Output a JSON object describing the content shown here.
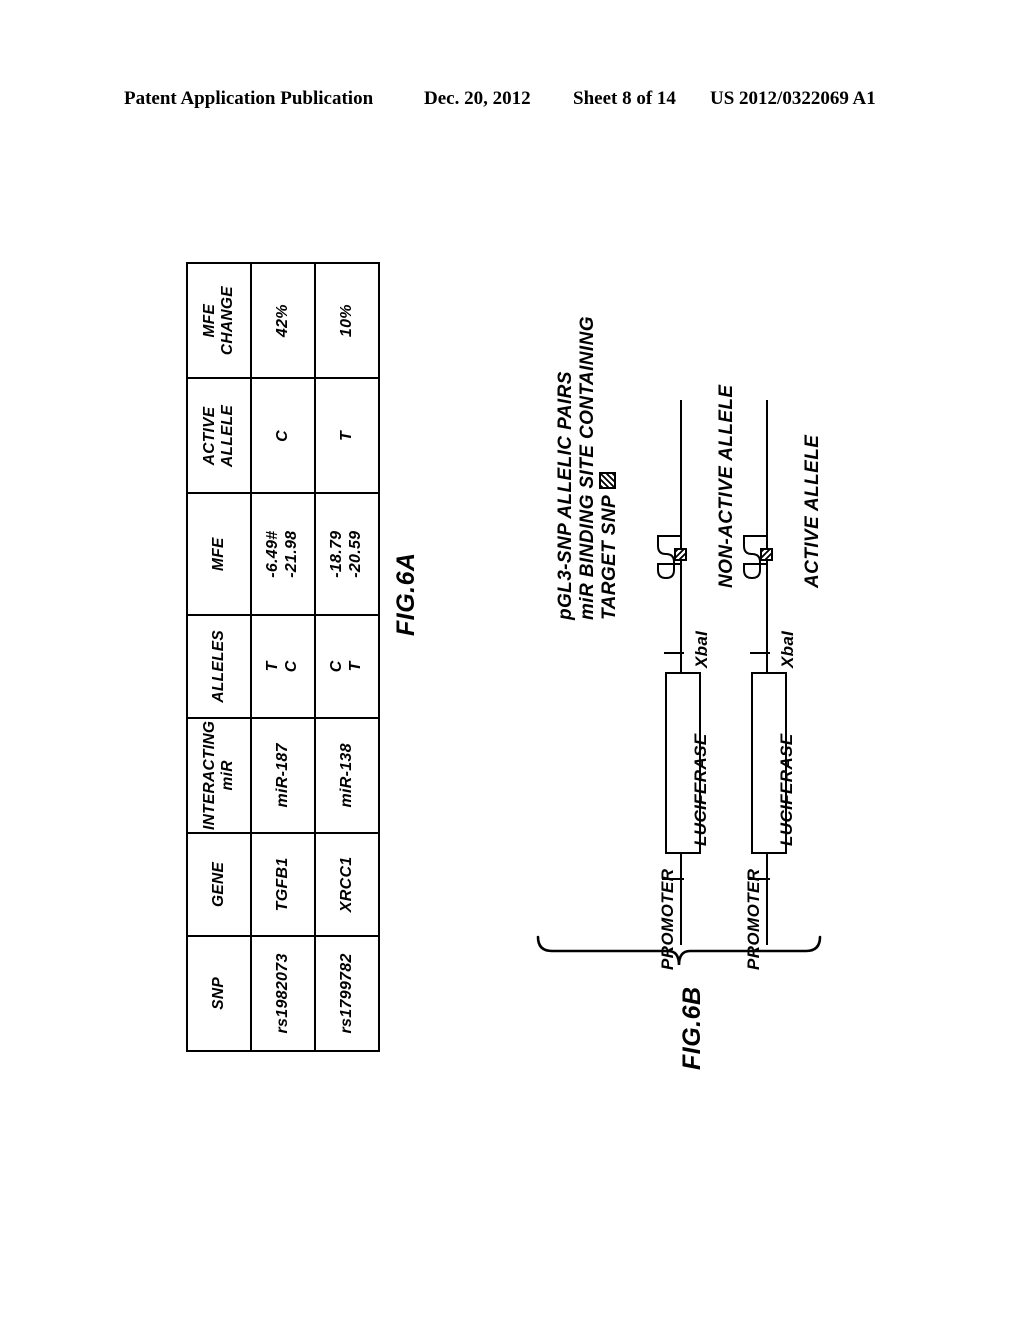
{
  "header": {
    "title": "Patent Application Publication",
    "date": "Dec. 20, 2012",
    "sheet": "Sheet 8 of 14",
    "doc_number": "US 2012/0322069 A1"
  },
  "figures": {
    "fig6a": {
      "caption": "FIG.6A",
      "table": {
        "columns": [
          "SNP",
          "GENE",
          "INTERACTING miR",
          "ALLELES",
          "MFE",
          "ACTIVE ALLELE",
          "MFE CHANGE"
        ],
        "column_headers_lines": [
          [
            "SNP"
          ],
          [
            "GENE"
          ],
          [
            "INTERACTING",
            "miR"
          ],
          [
            "ALLELES"
          ],
          [
            "MFE"
          ],
          [
            "ACTIVE",
            "ALLELE"
          ],
          [
            "MFE",
            "CHANGE"
          ]
        ],
        "rows": [
          {
            "snp": "rs1982073",
            "gene": "TGFB1",
            "interacting_mir": "miR-187",
            "alleles": [
              "T",
              "C"
            ],
            "mfe": [
              "-6.49#",
              "-21.98"
            ],
            "active_allele": "C",
            "mfe_change": "42%"
          },
          {
            "snp": "rs1799782",
            "gene": "XRCC1",
            "interacting_mir": "miR-138",
            "alleles": [
              "C",
              "T"
            ],
            "mfe": [
              "-18.79",
              "-20.59"
            ],
            "active_allele": "T",
            "mfe_change": "10%"
          }
        ]
      }
    },
    "fig6b": {
      "caption": "FIG.6B",
      "title_lines": [
        "pGL3-SNP ALLELIC PAIRS",
        "miR BINDING SITE CONTAINING",
        "TARGET SNP"
      ],
      "legend_symbol": "hatched-box-icon",
      "constructs": [
        {
          "promoter_label": "PROMOTER",
          "gene_label": "LUCIFERASE",
          "restriction_site": "XbaI",
          "allele_status": "NON-ACTIVE ALLELE"
        },
        {
          "promoter_label": "PROMOTER",
          "gene_label": "LUCIFERASE",
          "restriction_site": "XbaI",
          "allele_status": "ACTIVE ALLELE"
        }
      ]
    }
  },
  "colors": {
    "ink": "#000000",
    "paper": "#ffffff"
  }
}
